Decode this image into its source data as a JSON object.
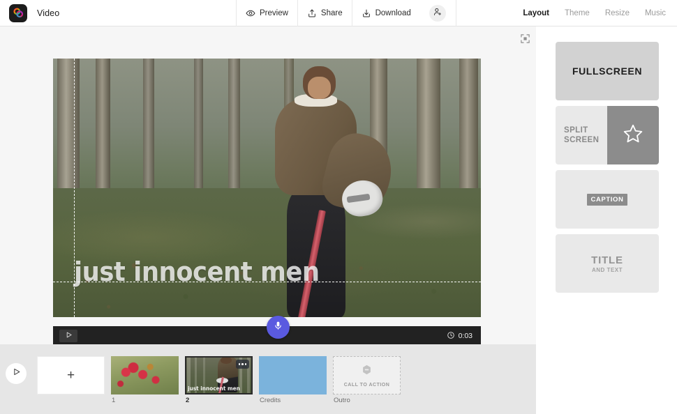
{
  "app": {
    "title": "Video",
    "logo_icon": "adobe-express-logo"
  },
  "toolbar": {
    "preview": {
      "label": "Preview",
      "icon": "eye-icon"
    },
    "share": {
      "label": "Share",
      "icon": "share-upload-icon"
    },
    "download": {
      "label": "Download",
      "icon": "download-icon"
    },
    "invite": {
      "icon": "person-add-icon"
    }
  },
  "nav": {
    "items": [
      {
        "label": "Layout",
        "active": true
      },
      {
        "label": "Theme",
        "active": false
      },
      {
        "label": "Resize",
        "active": false
      },
      {
        "label": "Music",
        "active": false
      }
    ]
  },
  "stage": {
    "fit_icon": "fit-to-screen-icon",
    "caption": "just innocent men",
    "guides": {
      "vertical": true,
      "horizontal": true
    }
  },
  "player": {
    "play_icon": "play-icon",
    "mic_icon": "microphone-icon",
    "mic_color": "#5a5ae0",
    "clock_icon": "clock-icon",
    "timecode": "0:03"
  },
  "timeline": {
    "play_icon": "play-circle-icon",
    "add_label": "+",
    "scenes": [
      {
        "label": "1",
        "selected": false,
        "kind": "flowers"
      },
      {
        "label": "2",
        "selected": true,
        "kind": "forest",
        "caption": "just innocent men",
        "menu_icon": "more-options-icon"
      },
      {
        "label": "Credits",
        "selected": false,
        "kind": "credits",
        "color": "#7bb3dc"
      },
      {
        "label": "Outro",
        "selected": false,
        "kind": "outro",
        "cta_label": "CALL TO ACTION",
        "badge_icon": "badge-icon"
      }
    ]
  },
  "layout_panel": {
    "options": [
      {
        "id": "fullscreen",
        "label": "FULLSCREEN",
        "selected": true
      },
      {
        "id": "split-screen",
        "label": "SPLIT\nSCREEN",
        "line1": "SPLIT",
        "line2": "SCREEN",
        "icon": "star-icon",
        "selected": false
      },
      {
        "id": "caption",
        "label": "CAPTION",
        "selected": false
      },
      {
        "id": "title-and-text",
        "line1": "TITLE",
        "line2": "AND TEXT",
        "selected": false
      }
    ]
  }
}
